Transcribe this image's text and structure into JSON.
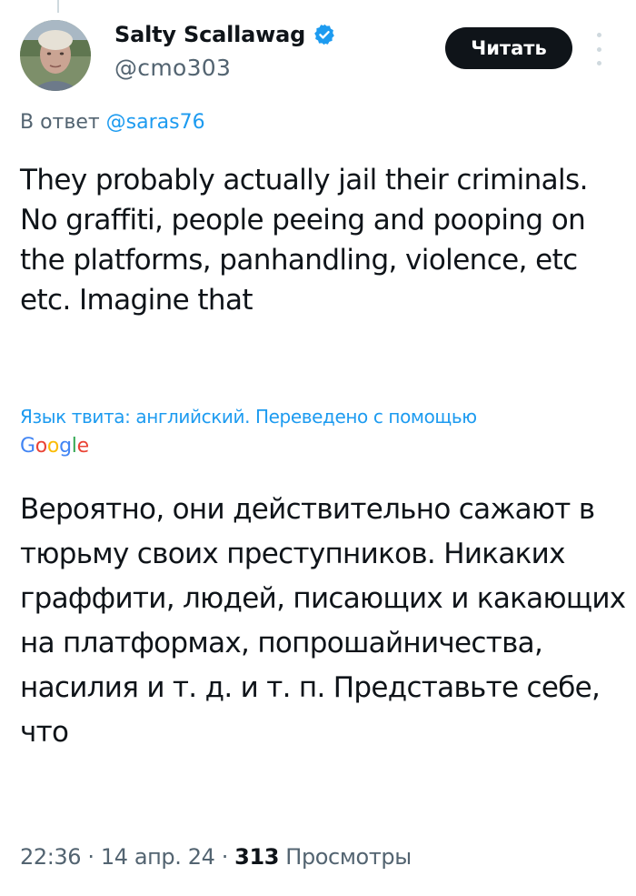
{
  "author": {
    "display_name": "Salty Scallawag",
    "handle": "@cmo303",
    "verified_icon": "verified-badge-icon",
    "avatar_icon": "avatar"
  },
  "header": {
    "follow_label": "Читать",
    "more_icon": "more-vertical-icon"
  },
  "reply": {
    "prefix": "В ответ ",
    "mention": "@saras76"
  },
  "tweet": {
    "text": "They probably actually jail their criminals. No graffiti, people peeing and pooping on the platforms, panhandling, violence, etc etc. Imagine that",
    "translation_note": "Язык твита: английский. Переведено с помощью",
    "translator_logo": [
      "G",
      "o",
      "o",
      "g",
      "l",
      "e"
    ],
    "translated_text": "Вероятно, они действительно сажают в тюрьму своих преступников. Никаких граффити, людей, писающих и какающих на платформах, попрошайничества, насилия и т. д. и т. п. Представьте себе, что"
  },
  "meta": {
    "time": "22:36",
    "separator": " · ",
    "date": "14 апр. 24",
    "views_count": "313",
    "views_label": " Просмотры"
  },
  "colors": {
    "accent": "#1d9bf0",
    "text": "#0f1419",
    "secondary": "#536471",
    "google": [
      "#4285F4",
      "#EA4335",
      "#FBBC05",
      "#4285F4",
      "#34A853",
      "#EA4335"
    ]
  }
}
